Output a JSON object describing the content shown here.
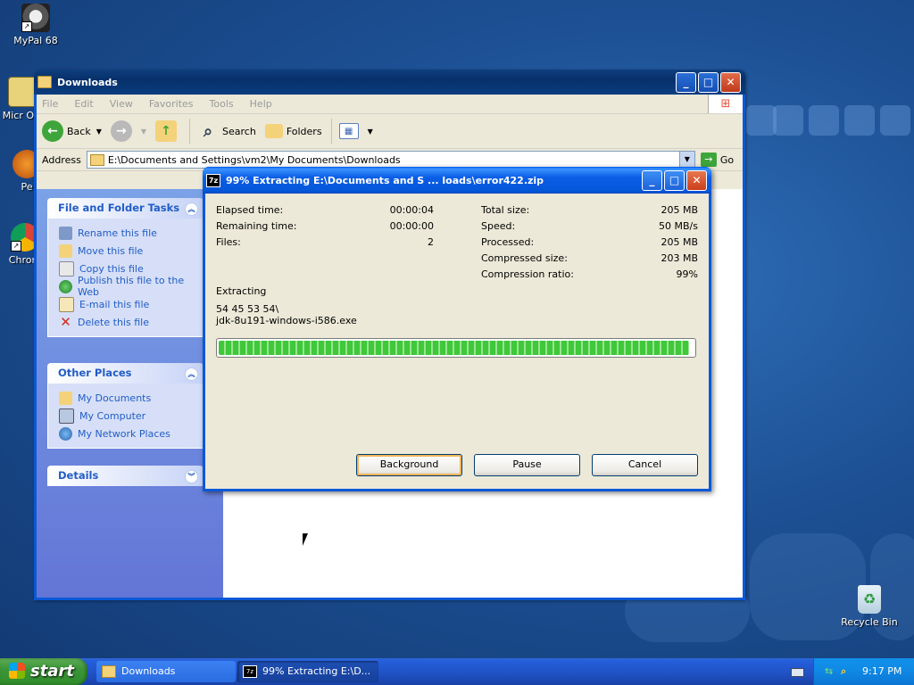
{
  "desktop": {
    "icons": [
      {
        "label": "MyPal 68",
        "icon": "raccoon-app-icon"
      },
      {
        "label": "Micr Out",
        "icon": "outlook-icon"
      },
      {
        "label": "Pe",
        "icon": "app-icon"
      },
      {
        "label": "Chrom",
        "icon": "chrome-icon"
      },
      {
        "label": "Recycle Bin",
        "icon": "recycle-bin-icon"
      }
    ]
  },
  "explorer": {
    "title": "Downloads",
    "menu": [
      "File",
      "Edit",
      "View",
      "Favorites",
      "Tools",
      "Help"
    ],
    "toolbar": {
      "back": "Back",
      "search": "Search",
      "folders": "Folders"
    },
    "address": {
      "label": "Address",
      "value": "E:\\Documents and Settings\\vm2\\My Documents\\Downloads",
      "go": "Go"
    },
    "tasks": {
      "title": "File and Folder Tasks",
      "items": [
        "Rename this file",
        "Move this file",
        "Copy this file",
        "Publish this file to the Web",
        "E-mail this file",
        "Delete this file"
      ]
    },
    "places": {
      "title": "Other Places",
      "items": [
        "My Documents",
        "My Computer",
        "My Network Places"
      ]
    },
    "details": {
      "title": "Details"
    }
  },
  "dialog": {
    "title": "99% Extracting E:\\Documents and S ... loads\\error422.zip",
    "left": {
      "elapsed_label": "Elapsed time:",
      "elapsed": "00:00:04",
      "remaining_label": "Remaining time:",
      "remaining": "00:00:00",
      "files_label": "Files:",
      "files": "2"
    },
    "right": {
      "total_label": "Total size:",
      "total": "205 MB",
      "speed_label": "Speed:",
      "speed": "50 MB/s",
      "processed_label": "Processed:",
      "processed": "205 MB",
      "compressed_label": "Compressed size:",
      "compressed": "203 MB",
      "ratio_label": "Compression ratio:",
      "ratio": "99%"
    },
    "status": "Extracting",
    "path_line1": "54 45 53 54\\",
    "path_line2": "jdk-8u191-windows-i586.exe",
    "progress_percent": 99,
    "buttons": {
      "background": "Background",
      "pause": "Pause",
      "cancel": "Cancel"
    }
  },
  "taskbar": {
    "start": "start",
    "tasks": [
      "Downloads",
      "99% Extracting E:\\D..."
    ],
    "clock": "9:17 PM"
  }
}
